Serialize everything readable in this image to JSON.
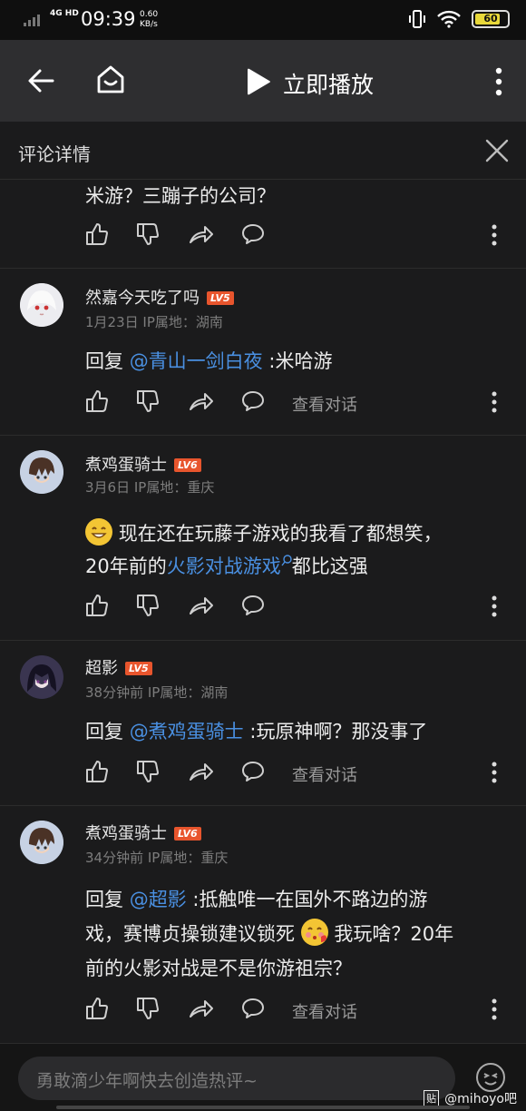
{
  "status_bar": {
    "network": "4G HD",
    "time": "09:39",
    "speed": "0.60",
    "speed_unit": "KB/s",
    "battery": "60"
  },
  "top_nav": {
    "play_label": "立即播放"
  },
  "panel": {
    "title": "评论详情"
  },
  "first_reply_tail": "米游？三蹦子的公司？",
  "replies": [
    {
      "username": "然嘉今天吃了吗",
      "level": "LV5",
      "meta": "1月23日 IP属地：湖南",
      "prefix": "回复 ",
      "mention": "@青山一剑白夜",
      "text": " :米哈游",
      "view_label": "查看对话"
    },
    {
      "username": "煮鸡蛋骑士",
      "level": "LV6",
      "meta": "3月6日 IP属地：重庆",
      "text_line1": "现在还在玩藤子游戏的我看了都想笑，",
      "text_line2a": "20年前的",
      "link": "火影对战游戏",
      "text_line2b": "都比这强"
    },
    {
      "username": "超影",
      "level": "LV5",
      "meta": "38分钟前 IP属地：湖南",
      "prefix": "回复 ",
      "mention": "@煮鸡蛋骑士",
      "text": " :玩原神啊？那没事了",
      "view_label": "查看对话"
    },
    {
      "username": "煮鸡蛋骑士",
      "level": "LV6",
      "meta": "34分钟前 IP属地：重庆",
      "prefix": "回复 ",
      "mention": "@超影",
      "text_line1": " :抵触唯一在国外不路边的游",
      "text_line2a": "戏，赛博贞操锁建议锁死 ",
      "text_line2b": " 我玩啥？20年",
      "text_line3": "前的火影对战是不是你游祖宗？",
      "view_label": "查看对话"
    }
  ],
  "bottom": {
    "placeholder": "勇敢滴少年啊快去创造热评~",
    "watermark": "@mihoyo吧",
    "watermark_badge": "贴"
  },
  "icons": [
    "back-icon",
    "home-icon",
    "play-icon",
    "more-icon",
    "close-icon",
    "like-icon",
    "dislike-icon",
    "share-icon",
    "comment-icon",
    "emoji-icon"
  ]
}
